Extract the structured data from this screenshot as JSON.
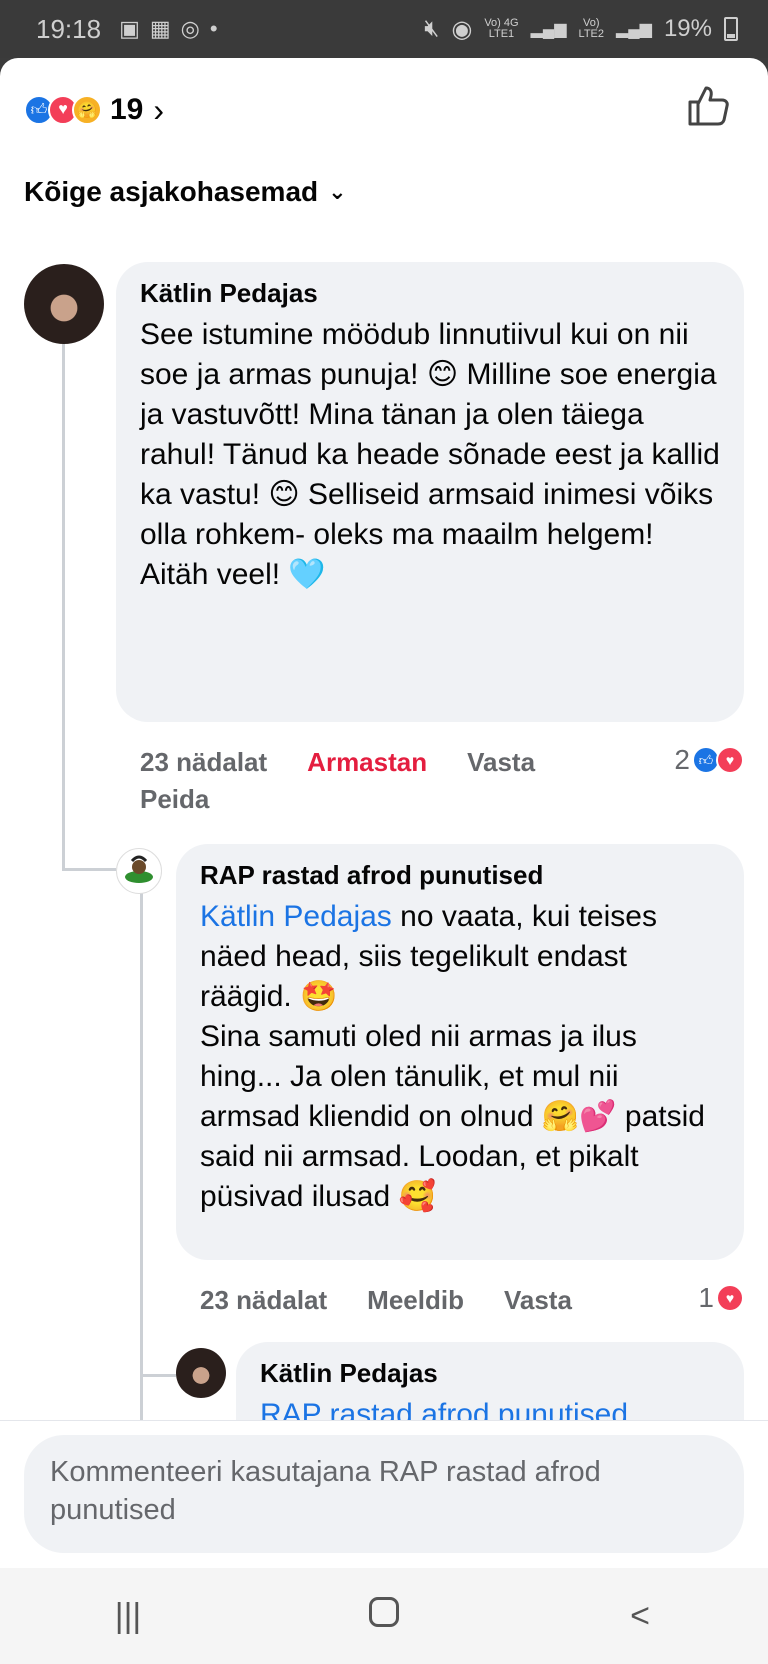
{
  "status_bar": {
    "time": "19:18",
    "battery": "19%",
    "net1": "Vo) 4G\nLTE1",
    "net2": "Vo)\nLTE2"
  },
  "reactions": {
    "count": "19"
  },
  "sort_label": "Kõige asjakohasemad",
  "comments": [
    {
      "author": "Kätlin Pedajas",
      "text": "See istumine möödub linnutiivul kui on nii soe ja armas punuja! 😊 Milline soe energia ja vastuvõtt! Mina tänan ja olen täiega rahul! Tänud ka heade sõnade eest ja kallid ka vastu! 😊 Selliseid armsaid inimesi võiks olla rohkem- oleks ma maailm helgem!\nAitäh veel! 🩵",
      "time": "23 nädalat",
      "like_label": "Armastan",
      "reply_label": "Vasta",
      "hide_label": "Peida",
      "reaction_count": "2"
    },
    {
      "author": "RAP rastad afrod punutised",
      "mention": "Kätlin Pedajas",
      "text": " no vaata, kui teises näed head, siis tegelikult endast räägid. 🤩\nSina samuti oled nii armas ja ilus hing... Ja olen tänulik, et mul nii armsad kliendid on olnud 🤗💕 patsid said nii armsad. Loodan, et pikalt püsivad ilusad 🥰",
      "time": "23 nädalat",
      "like_label": "Meeldib",
      "reply_label": "Vasta",
      "reaction_count": "1"
    },
    {
      "author": "Kätlin Pedajas",
      "text_partial": "RAP rastad afrod punutised"
    }
  ],
  "composer": {
    "placeholder": "Kommenteeri kasutajana RAP rastad afrod punutised"
  },
  "navbar": {
    "recent": "|||",
    "back": "<"
  }
}
